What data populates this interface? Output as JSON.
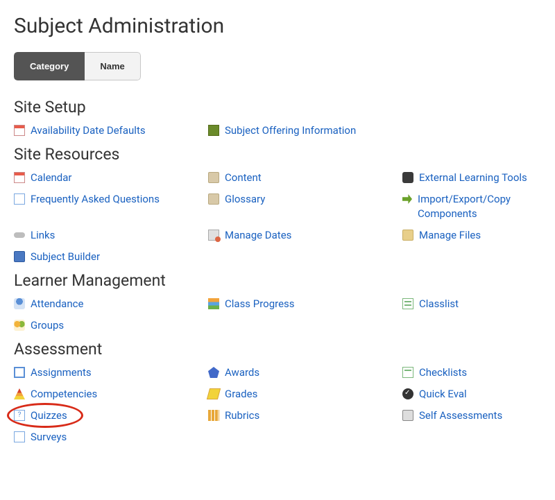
{
  "page_title": "Subject Administration",
  "toggle": {
    "category": "Category",
    "name": "Name"
  },
  "sections": {
    "site_setup": {
      "heading": "Site Setup",
      "availability": "Availability Date Defaults",
      "offering": "Subject Offering Information"
    },
    "site_resources": {
      "heading": "Site Resources",
      "calendar": "Calendar",
      "content": "Content",
      "external": "External Learning Tools",
      "faq": "Frequently Asked Questions",
      "glossary": "Glossary",
      "import": "Import/Export/Copy Components",
      "links": "Links",
      "manage_dates": "Manage Dates",
      "manage_files": "Manage Files",
      "subject_builder": "Subject Builder"
    },
    "learner_mgmt": {
      "heading": "Learner Management",
      "attendance": "Attendance",
      "class_progress": "Class Progress",
      "classlist": "Classlist",
      "groups": "Groups"
    },
    "assessment": {
      "heading": "Assessment",
      "assignments": "Assignments",
      "awards": "Awards",
      "checklists": "Checklists",
      "competencies": "Competencies",
      "grades": "Grades",
      "quick_eval": "Quick Eval",
      "quizzes": "Quizzes",
      "rubrics": "Rubrics",
      "self_assess": "Self Assessments",
      "surveys": "Surveys"
    }
  }
}
